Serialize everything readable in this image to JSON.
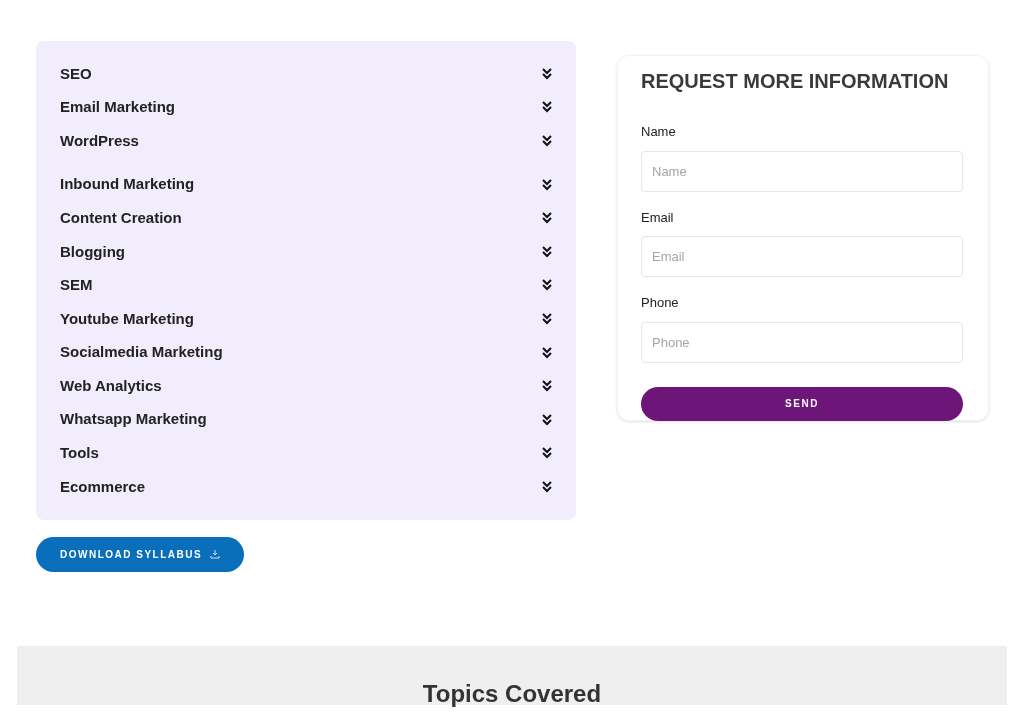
{
  "syllabus": {
    "items": [
      {
        "label": "SEO",
        "expanded": false
      },
      {
        "label": "Email Marketing",
        "expanded": false
      },
      {
        "label": "WordPress",
        "expanded": false
      },
      {
        "label": "Inbound Marketing",
        "expanded": false
      },
      {
        "label": "Content Creation",
        "expanded": false
      },
      {
        "label": "Blogging",
        "expanded": false
      },
      {
        "label": "SEM",
        "expanded": false
      },
      {
        "label": "Youtube Marketing",
        "expanded": false
      },
      {
        "label": "Socialmedia Marketing",
        "expanded": false
      },
      {
        "label": "Web Analytics",
        "expanded": false
      },
      {
        "label": "Whatsapp Marketing",
        "expanded": false
      },
      {
        "label": "Tools",
        "expanded": false
      },
      {
        "label": "Ecommerce",
        "expanded": false
      }
    ],
    "download_button": "DOWNLOAD SYLLABUS"
  },
  "form": {
    "title": "REQUEST MORE INFORMATION",
    "fields": [
      {
        "label": "Name",
        "placeholder": "Name"
      },
      {
        "label": "Email",
        "placeholder": "Email"
      },
      {
        "label": "Phone",
        "placeholder": "Phone"
      }
    ],
    "submit": "SEND"
  },
  "section": {
    "title": "Topics Covered"
  }
}
